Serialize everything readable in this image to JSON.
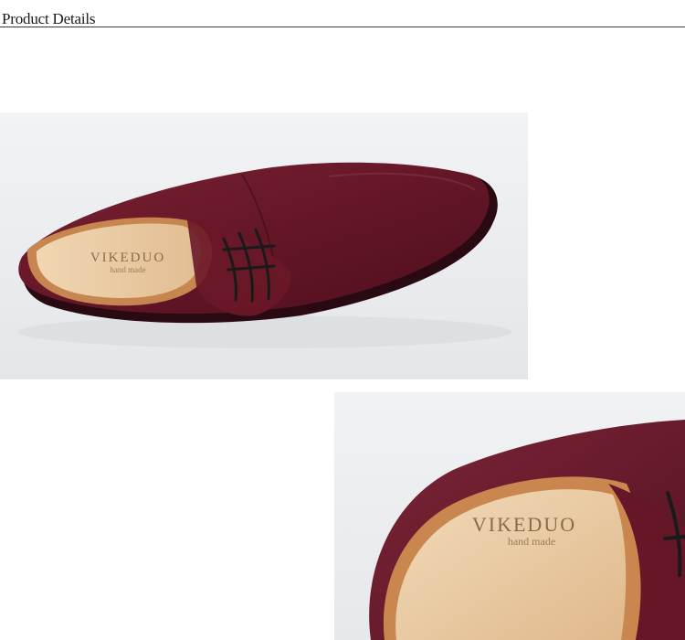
{
  "header": {
    "title": "Product Details"
  },
  "photos": [
    {
      "subject": "wine-red suede lace-up derby shoe, side view",
      "insole_brand": "VIKEDUO",
      "insole_tagline": "hand made"
    },
    {
      "subject": "close-up of shoe opening showing insole",
      "insole_brand": "VIKEDUO",
      "insole_tagline": "hand made"
    }
  ],
  "colors": {
    "suede": "#6e1a2a",
    "suede_dark": "#4a0f1c",
    "lining": "#e8c9a2",
    "background": "#eef0f2",
    "rule": "#3a3a3a"
  }
}
